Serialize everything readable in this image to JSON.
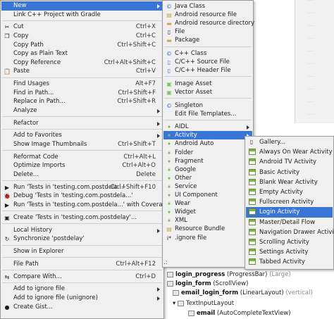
{
  "main_menu": [
    {
      "label": "New",
      "shortcut": "",
      "submenu": true,
      "highlighted": true,
      "icon": ""
    },
    {
      "label": "Link C++ Project with Gradle",
      "shortcut": "",
      "submenu": false,
      "icon": ""
    },
    {
      "sep": true
    },
    {
      "label": "Cut",
      "shortcut": "Ctrl+X",
      "icon": "scissors-icon",
      "glyph": "✂"
    },
    {
      "label": "Copy",
      "shortcut": "Ctrl+C",
      "icon": "copy-icon",
      "glyph": "❐"
    },
    {
      "label": "Copy Path",
      "shortcut": "Ctrl+Shift+C",
      "icon": ""
    },
    {
      "label": "Copy as Plain Text",
      "shortcut": "",
      "icon": ""
    },
    {
      "label": "Copy Reference",
      "shortcut": "Ctrl+Alt+Shift+C",
      "icon": ""
    },
    {
      "label": "Paste",
      "shortcut": "Ctrl+V",
      "icon": "paste-icon",
      "glyph": "📋"
    },
    {
      "sep": true
    },
    {
      "label": "Find Usages",
      "shortcut": "Alt+F7",
      "icon": ""
    },
    {
      "label": "Find in Path...",
      "shortcut": "Ctrl+Shift+F",
      "icon": ""
    },
    {
      "label": "Replace in Path...",
      "shortcut": "Ctrl+Shift+R",
      "icon": ""
    },
    {
      "label": "Analyze",
      "shortcut": "",
      "submenu": true,
      "icon": ""
    },
    {
      "sep": true
    },
    {
      "label": "Refactor",
      "shortcut": "",
      "submenu": true,
      "icon": ""
    },
    {
      "sep": true
    },
    {
      "label": "Add to Favorites",
      "shortcut": "",
      "submenu": true,
      "icon": ""
    },
    {
      "label": "Show Image Thumbnails",
      "shortcut": "Ctrl+Shift+T",
      "icon": ""
    },
    {
      "sep": true
    },
    {
      "label": "Reformat Code",
      "shortcut": "Ctrl+Alt+L",
      "icon": ""
    },
    {
      "label": "Optimize Imports",
      "shortcut": "Ctrl+Alt+O",
      "icon": ""
    },
    {
      "label": "Delete...",
      "shortcut": "Delete",
      "icon": ""
    },
    {
      "sep": true
    },
    {
      "label": "Run 'Tests in 'testing.com.postdela...'",
      "shortcut": "Ctrl+Shift+F10",
      "icon": "run-icon",
      "glyph": "▶"
    },
    {
      "label": "Debug 'Tests in 'testing.com.postdela...'",
      "shortcut": "",
      "icon": "debug-icon",
      "glyph": "🐞"
    },
    {
      "label": "Run 'Tests in 'testing.com.postdela...' with Coverage",
      "shortcut": "",
      "icon": "coverage-icon",
      "glyph": "▶"
    },
    {
      "sep": true
    },
    {
      "label": "Create 'Tests in 'testing.com.postdelay'...",
      "shortcut": "",
      "icon": "create-test-icon",
      "glyph": "▣"
    },
    {
      "sep": true
    },
    {
      "label": "Local History",
      "shortcut": "",
      "submenu": true,
      "icon": ""
    },
    {
      "label": "Synchronize 'postdelay'",
      "shortcut": "",
      "icon": "sync-icon",
      "glyph": "↻"
    },
    {
      "sep": true
    },
    {
      "label": "Show in Explorer",
      "shortcut": "",
      "icon": ""
    },
    {
      "sep": true
    },
    {
      "label": "File Path",
      "shortcut": "Ctrl+Alt+F12",
      "icon": ""
    },
    {
      "sep": true
    },
    {
      "label": "Compare With...",
      "shortcut": "Ctrl+D",
      "icon": "compare-icon",
      "glyph": "⇆"
    },
    {
      "sep": true
    },
    {
      "label": "Add to ignore file",
      "shortcut": "",
      "submenu": true,
      "icon": ""
    },
    {
      "label": "Add to ignore file (unignore)",
      "shortcut": "",
      "submenu": true,
      "icon": ""
    },
    {
      "label": "Create Gist...",
      "shortcut": "",
      "icon": "gist-icon",
      "glyph": "●"
    }
  ],
  "new_menu": [
    {
      "label": "Java Class",
      "icon": "java-class-icon",
      "glyph": "©",
      "kind": "blue"
    },
    {
      "label": "Android resource file",
      "icon": "android-resource-file-icon",
      "glyph": "▤",
      "kind": "folder"
    },
    {
      "label": "Android resource directory",
      "icon": "folder-icon",
      "glyph": "▬",
      "kind": "folder"
    },
    {
      "label": "File",
      "icon": "file-icon",
      "glyph": "▯",
      "kind": ""
    },
    {
      "label": "Package",
      "icon": "package-icon",
      "glyph": "▬",
      "kind": "folder"
    },
    {
      "sep": true
    },
    {
      "label": "C++ Class",
      "icon": "cpp-class-icon",
      "glyph": "©",
      "kind": "blue"
    },
    {
      "label": "C/C++ Source File",
      "icon": "cpp-source-icon",
      "glyph": "▯",
      "kind": "blue"
    },
    {
      "label": "C/C++ Header File",
      "icon": "cpp-header-icon",
      "glyph": "▯",
      "kind": "blue"
    },
    {
      "sep": true
    },
    {
      "label": "Image Asset",
      "icon": "image-asset-icon",
      "glyph": "▣",
      "kind": "andr"
    },
    {
      "label": "Vector Asset",
      "icon": "vector-asset-icon",
      "glyph": "▣",
      "kind": "andr"
    },
    {
      "sep": true
    },
    {
      "label": "Singleton",
      "icon": "singleton-icon",
      "glyph": "©",
      "kind": "blue"
    },
    {
      "label": "Edit File Templates...",
      "icon": "",
      "glyph": "",
      "kind": ""
    },
    {
      "sep": true
    },
    {
      "label": "AIDL",
      "icon": "android-icon",
      "glyph": "✦",
      "kind": "andr",
      "submenu": true
    },
    {
      "label": "Activity",
      "icon": "android-icon",
      "glyph": "✦",
      "kind": "andr",
      "submenu": true,
      "highlighted": true
    },
    {
      "label": "Android Auto",
      "icon": "android-icon",
      "glyph": "✦",
      "kind": "andr",
      "submenu": true
    },
    {
      "label": "Folder",
      "icon": "android-icon",
      "glyph": "✦",
      "kind": "andr",
      "submenu": true
    },
    {
      "label": "Fragment",
      "icon": "android-icon",
      "glyph": "✦",
      "kind": "andr",
      "submenu": true
    },
    {
      "label": "Google",
      "icon": "android-icon",
      "glyph": "✦",
      "kind": "andr",
      "submenu": true
    },
    {
      "label": "Other",
      "icon": "android-icon",
      "glyph": "✦",
      "kind": "andr",
      "submenu": true
    },
    {
      "label": "Service",
      "icon": "android-icon",
      "glyph": "✦",
      "kind": "andr",
      "submenu": true
    },
    {
      "label": "UI Component",
      "icon": "android-icon",
      "glyph": "✦",
      "kind": "andr",
      "submenu": true
    },
    {
      "label": "Wear",
      "icon": "android-icon",
      "glyph": "✦",
      "kind": "andr",
      "submenu": true
    },
    {
      "label": "Widget",
      "icon": "android-icon",
      "glyph": "✦",
      "kind": "andr",
      "submenu": true
    },
    {
      "label": "XML",
      "icon": "android-icon",
      "glyph": "✦",
      "kind": "andr",
      "submenu": true
    },
    {
      "label": "Resource Bundle",
      "icon": "resource-bundle-icon",
      "glyph": "▤",
      "kind": "folder"
    },
    {
      "label": ".ignore file",
      "icon": "ignore-file-icon",
      "glyph": "i*",
      "kind": "",
      "submenu": true
    }
  ],
  "activity_menu": [
    {
      "label": "Gallery...",
      "icon": "gallery-icon",
      "glyph": "▯"
    },
    {
      "label": "Always On Wear Activity",
      "icon": "activity-template-icon"
    },
    {
      "label": "Android TV Activity",
      "icon": "activity-template-icon"
    },
    {
      "label": "Basic Activity",
      "icon": "activity-template-icon"
    },
    {
      "label": "Blank Wear Activity",
      "icon": "activity-template-icon"
    },
    {
      "label": "Empty Activity",
      "icon": "activity-template-icon"
    },
    {
      "label": "Fullscreen Activity",
      "icon": "activity-template-icon"
    },
    {
      "label": "Login Activity",
      "icon": "activity-template-icon",
      "highlighted": true
    },
    {
      "label": "Master/Detail Flow",
      "icon": "activity-template-icon"
    },
    {
      "label": "Navigation Drawer Activity",
      "icon": "activity-template-icon"
    },
    {
      "label": "Scrolling Activity",
      "icon": "activity-template-icon"
    },
    {
      "label": "Settings Activity",
      "icon": "activity-template-icon"
    },
    {
      "label": "Tabbed Activity",
      "icon": "activity-template-icon"
    }
  ],
  "component_tree": {
    "dots": ".:",
    "rows": [
      {
        "name": "login_progress",
        "type": "(ProgressBar)",
        "hint": "(Large)"
      },
      {
        "name": "login_form",
        "type": "(ScrollView)",
        "hint": ""
      },
      {
        "name": "email_login_form",
        "type": "(LinearLayout)",
        "hint": "(vertical)"
      },
      {
        "name": "",
        "type": "TextInputLayout",
        "hint": ""
      },
      {
        "name": "email",
        "type": "(AutoCompleteTextView)",
        "hint": ""
      }
    ]
  },
  "colors": {
    "menu_bg": "#f0f0f0",
    "highlight": "#3875d7",
    "android_green": "#78c257"
  }
}
